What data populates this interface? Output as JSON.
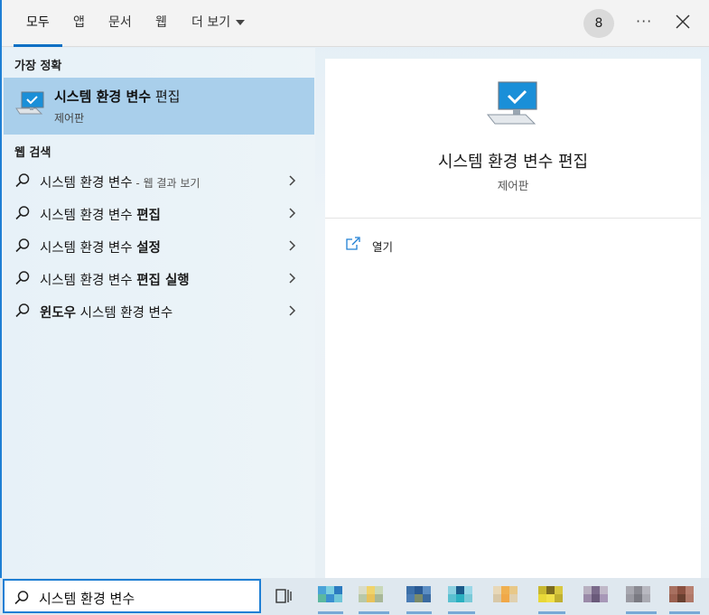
{
  "topnav": {
    "tabs": [
      {
        "label": "모두",
        "active": true
      },
      {
        "label": "앱"
      },
      {
        "label": "문서"
      },
      {
        "label": "웹"
      },
      {
        "label": "더 보기"
      }
    ],
    "badge_count": "8",
    "more_icon": "more-icon",
    "close_icon": "close-icon"
  },
  "best_match": {
    "section_title": "가장 정확",
    "title_bold": "시스템 환경 변수",
    "title_rest": " 편집",
    "subtitle": "제어판",
    "icon": "computer-check-icon"
  },
  "web_search": {
    "section_title": "웹 검색",
    "items": [
      {
        "normal": "시스템 환경 변수",
        "bold": "",
        "suffix": " - 웹 결과 보기"
      },
      {
        "normal": "시스템 환경 변수 ",
        "bold": "편집",
        "suffix": ""
      },
      {
        "normal": "시스템 환경 변수 ",
        "bold": "설정",
        "suffix": ""
      },
      {
        "normal": "시스템 환경 변수 ",
        "bold": "편집 실행",
        "suffix": ""
      },
      {
        "normal": " 시스템 환경 변수",
        "bold": "윈도우",
        "suffix": "",
        "bold_first": true
      }
    ]
  },
  "detail": {
    "title": "시스템 환경 변수 편집",
    "subtitle": "제어판",
    "actions": [
      {
        "label": "열기",
        "icon": "open-external-icon"
      }
    ]
  },
  "taskbar": {
    "search_query": "시스템 환경 변수",
    "accent": "#1f7fd4"
  }
}
